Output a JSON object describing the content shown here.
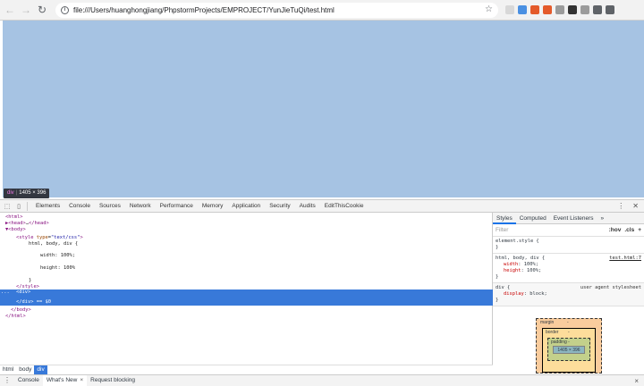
{
  "browser": {
    "url": "file:///Users/huanghongjiang/PhpstormProjects/EMPROJECT/YunJieTuQi/test.html",
    "info_glyph": "i",
    "extension_colors": [
      "#d8d8d8",
      "#4a90e2",
      "#e45a2a",
      "#e45a2a",
      "#9b9b9b",
      "#333333",
      "#9b9b9b",
      "#5f6368",
      "#5f6368"
    ]
  },
  "viewport": {
    "highlight_color": "#a6c3e3",
    "tooltip": {
      "tag": "div",
      "size": "1405 × 396"
    }
  },
  "devtools": {
    "tabs": [
      "Elements",
      "Console",
      "Sources",
      "Network",
      "Performance",
      "Memory",
      "Application",
      "Security",
      "Audits",
      "EditThisCookie"
    ],
    "selected_tab": "Elements",
    "dom": {
      "l1": "<html>",
      "l2a": "▶<head>",
      "l2b": "…",
      "l2c": "</head>",
      "l3": "▼<body>",
      "l4a": "<style",
      "l4b": "type",
      "l4c": "\"text/css\"",
      "l4d": ">",
      "l5": "html, body, div {",
      "l6": "width: 100%;",
      "l7": "height: 100%",
      "l8": "}",
      "l9": "</style>",
      "l10": "<div>",
      "l11": "</div>",
      "l11b": "== $0",
      "l12": "</body>",
      "l13": "</html>",
      "dots": "..."
    },
    "breadcrumbs": [
      "html",
      "body",
      "div"
    ],
    "styles": {
      "tabs": [
        "Styles",
        "Computed",
        "Event Listeners",
        "»"
      ],
      "filter_placeholder": "Filter",
      "filter_hov": ":hov",
      "filter_cls": ".cls",
      "filter_plus": "+",
      "rules": [
        {
          "selector": "element.style {",
          "close": "}"
        },
        {
          "selector": "html, body, div {",
          "source": "test.html:7",
          "props": [
            {
              "name": "width",
              "value": "100%;"
            },
            {
              "name": "height",
              "value": "100%;"
            }
          ],
          "close": "}"
        },
        {
          "selector": "div {",
          "source": "user agent stylesheet",
          "props": [
            {
              "name": "display",
              "value": "block;"
            }
          ],
          "close": "}"
        }
      ],
      "box_model": {
        "margin_label": "margin",
        "border_label": "border",
        "padding_label": "padding -",
        "content": "1405 × 396",
        "dash": "-"
      }
    },
    "drawer": {
      "tabs": [
        "Console",
        "What's New",
        "Request blocking"
      ],
      "selected": "What's New",
      "close_glyph": "×"
    }
  }
}
